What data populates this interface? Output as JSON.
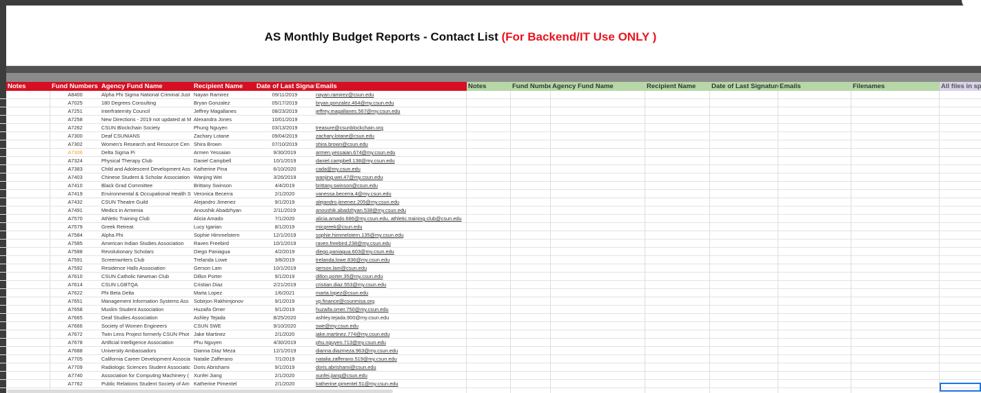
{
  "title": {
    "main": "AS Monthly Budget  Reports - Contact List",
    "highlight": "(For Backend/IT Use ONLY )"
  },
  "headers_left": [
    "Notes",
    "Fund Numbers",
    "Agency Fund Name",
    "Recipient Name",
    "Date of Last Signature",
    "Emails"
  ],
  "headers_right": [
    "Notes",
    "Fund Numbe",
    "Agency Fund Name",
    "Recipient Name",
    "Date of Last Signature",
    "Emails",
    "Filenames",
    "All files in sp"
  ],
  "rows": [
    {
      "fund": "A8400",
      "agency": "Alpha Phi Sigma National Criminal Just",
      "recipient": "Nayan Ramirez",
      "date": "09/11/2019",
      "email": "nayan.ramirez@csun.edu"
    },
    {
      "fund": "A7025",
      "agency": "180 Degrees Consulting",
      "recipient": "Bryan Gonzalez",
      "date": "05/17/2019",
      "email": "bryan.gonzalez.464@my.csun.edu"
    },
    {
      "fund": "A7251",
      "agency": "Interfraternity Council",
      "recipient": "Jeffrey Magallanes",
      "date": "08/23/2019",
      "email": "jeffrey.magallanes.567@my.csun.edu"
    },
    {
      "fund": "A7258",
      "agency": "New Directions - 2019 not updated at M",
      "recipient": "Alexandra Jones",
      "date": "10/01/2019",
      "email": ""
    },
    {
      "fund": "A7262",
      "agency": "CSUN Blockchain Society",
      "recipient": "Phung Nguyen",
      "date": "03/13/2019",
      "email": "treasure@csunblockchain.org"
    },
    {
      "fund": "A7300",
      "agency": "Deaf CSUNIANS",
      "recipient": "Zachary Lotane",
      "date": "09/04/2019",
      "email": "zachary.lotane@csun.edu"
    },
    {
      "fund": "A7302",
      "agency": "Women's Research and Resource Cen",
      "recipient": "Shira Brown",
      "date": "07/10/2019",
      "email": "shira.brown@csun.edu"
    },
    {
      "fund": "A7308",
      "agency": "Delta Sigma Pi",
      "recipient": "Armen Yessaian",
      "date": "9/30/2019",
      "email": "armen.yessaian.674@my.csun.edu",
      "orange": true
    },
    {
      "fund": "A7324",
      "agency": "Physical Therapy Club",
      "recipient": "Daniel Campbell",
      "date": "10/1/2019",
      "email": "daniel.campbell.138@my.csun.edu"
    },
    {
      "fund": "A7383",
      "agency": "Child and Adolescent Development Ass",
      "recipient": "Katherine Pina",
      "date": "6/10/2020",
      "email": "cada@my.csun.edu"
    },
    {
      "fund": "A7403",
      "agency": "Chinese Student & Scholar Association",
      "recipient": "Wanjing Wei",
      "date": "3/26/2019",
      "email": "wanjing.wei.47@my.csun.edu"
    },
    {
      "fund": "A7410",
      "agency": "Black Grad Committee",
      "recipient": "Brittany Swinson",
      "date": "4/4/2019",
      "email": "brittany.swinson@csun.edu"
    },
    {
      "fund": "A7419",
      "agency": "Environmental & Occupational Health S",
      "recipient": "Veronica Becerra",
      "date": "2/1/2020",
      "email": "vanessa.becerra.4@my.csun.edu"
    },
    {
      "fund": "A7432",
      "agency": "CSUN Theatre Guild",
      "recipient": "Alejandro Jimenez",
      "date": "9/1/2019",
      "email": "alejandro.jimenez.205@my.csun.edu"
    },
    {
      "fund": "A7491",
      "agency": "Medics in Armenia",
      "recipient": "Anoushik Abadzhyan",
      "date": "2/11/2019",
      "email": "anoushik.abadzhyan.538@my.csun.edu"
    },
    {
      "fund": "A7570",
      "agency": "Athletic Training Club",
      "recipient": "Alicia Amado",
      "date": "7/1/2020",
      "email": "alicia.amado.686@my.csun.edu, athletic.training.club@csun.edu"
    },
    {
      "fund": "A7579",
      "agency": "Greek Retreat",
      "recipient": "Lucy Igarian",
      "date": "8/1/2019",
      "email": "micgreek@csun.edu"
    },
    {
      "fund": "A7584",
      "agency": "Alpha Phi",
      "recipient": "Sophie Himmelstern",
      "date": "12/1/2019",
      "email": "sophie.himmelstern.135@my.csun.edu"
    },
    {
      "fund": "A7585",
      "agency": "American Indian Studies Association",
      "recipient": "Raven Freebird",
      "date": "10/1/2019",
      "email": "raven.freebird.238@my.csun.edu"
    },
    {
      "fund": "A7588",
      "agency": "Revolutionary Scholars",
      "recipient": "Diego Paniagua",
      "date": "4/2/2019",
      "email": "diego.paniagua.603@my.csun.edu"
    },
    {
      "fund": "A7591",
      "agency": "Screenwriters Club",
      "recipient": "Trelanda Lowe",
      "date": "3/8/2019",
      "email": "trelanda.lowe.836@my.csun.edu"
    },
    {
      "fund": "A7592",
      "agency": "Residence Halls Association",
      "recipient": "Gerson Lam",
      "date": "10/1/2019",
      "email": "gerson.lam@csun.edu"
    },
    {
      "fund": "A7610",
      "agency": "CSUN Catholic Newman Club",
      "recipient": "Dillon Porter",
      "date": "9/1/2019",
      "email": "dillon.porter.35@my.csun.edu"
    },
    {
      "fund": "A7614",
      "agency": "CSUN LGBTQA",
      "recipient": "Cristian Diaz",
      "date": "2/21/2019",
      "email": "cristian.diaz.553@my.csun.edu"
    },
    {
      "fund": "A7622",
      "agency": "Phi Beta Delta",
      "recipient": "Marta Lopez",
      "date": "1/6/2021",
      "email": "marta.lopez@csun.edu"
    },
    {
      "fund": "A7651",
      "agency": "Management Information Systems Ass",
      "recipient": "Sobirjon Rakhimjonov",
      "date": "9/1/2019",
      "email": "vp.finance@csunmisa.org"
    },
    {
      "fund": "A7658",
      "agency": "Muslim Student Association",
      "recipient": "Huzaifa Omer",
      "date": "9/1/2019",
      "email": "huzaifa.omer.750@my.csun.edu"
    },
    {
      "fund": "A7665",
      "agency": "Deaf Studies Association",
      "recipient": "Ashley Tejada",
      "date": "8/25/2020",
      "email": "ashley.tejada.900@my.csun.edu",
      "plain": true
    },
    {
      "fund": "A7666",
      "agency": "Society of Women Engineers",
      "recipient": "CSUN SWE",
      "date": "9/10/2020",
      "email": "swe@my.csun.edu"
    },
    {
      "fund": "A7672",
      "agency": "Twin Lens Project formerly CSUN Phot",
      "recipient": "Jake Martinez",
      "date": "2/1/2020",
      "email": "jake.martinez.774@my.csun.edu"
    },
    {
      "fund": "A7678",
      "agency": "Artificial Intelligence Association",
      "recipient": "Phu Nguyen",
      "date": "4/30/2019",
      "email": "phu.nguyen.713@my.csun.edu"
    },
    {
      "fund": "A7688",
      "agency": "University Ambassadors",
      "recipient": "Dianna Diaz Meza",
      "date": "12/1/2019",
      "email": "dianna.diazmeza.963@my.csun.edu"
    },
    {
      "fund": "A7705",
      "agency": "California Career Development Associa",
      "recipient": "Natalie Zafferano",
      "date": "7/1/2019",
      "email": "natalia.zafferano.519@my.csun.edu"
    },
    {
      "fund": "A7709",
      "agency": "Radiologic Sciences Student Associatic",
      "recipient": "Doris Abrishami",
      "date": "9/1/2019",
      "email": "doris.abrishami@csun.edu"
    },
    {
      "fund": "A7740",
      "agency": "Association for Computing Machinery (",
      "recipient": "Xunfei Jiang",
      "date": "2/1/2020",
      "email": "xunfei.jiang@csun.edu"
    },
    {
      "fund": "A7762",
      "agency": "Public Relations Student Society of Am",
      "recipient": "Katherine Pimentel",
      "date": "2/1/2020",
      "email": "katherine.pimentel.51@my.csun.edu"
    }
  ],
  "colors": {
    "header_red": "#d60f22",
    "header_green": "#b7d7a8",
    "header_purple": "#d9d2e9",
    "title_highlight": "#e8141c",
    "fund_orange": "#f0a030"
  }
}
